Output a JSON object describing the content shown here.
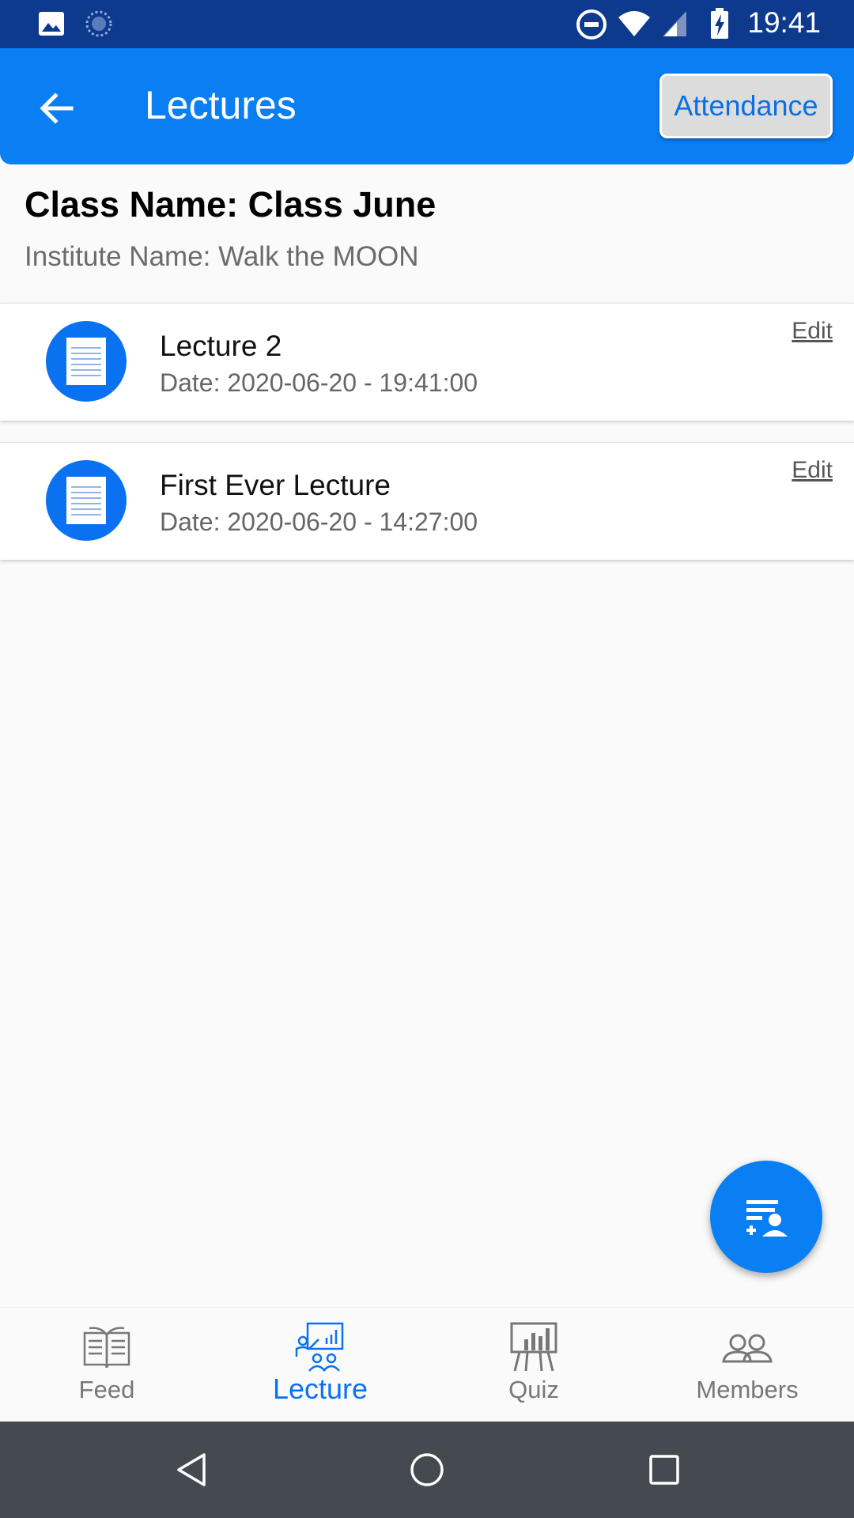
{
  "status_bar": {
    "time": "19:41",
    "icons": [
      "image-icon",
      "loading-icon",
      "do-not-disturb-icon",
      "wifi-icon",
      "signal-icon",
      "battery-charging-icon"
    ]
  },
  "app_bar": {
    "title": "Lectures",
    "back_icon": "arrow-back-icon",
    "attendance_label": "Attendance"
  },
  "class_info": {
    "class_name": "Class Name: Class June",
    "institute_name": "Institute Name: Walk the MOON"
  },
  "lectures": [
    {
      "title": "Lecture 2",
      "date": "Date: 2020-06-20 - 19:41:00",
      "edit_label": "Edit",
      "icon": "document-icon"
    },
    {
      "title": "First Ever Lecture",
      "date": "Date: 2020-06-20 - 14:27:00",
      "edit_label": "Edit",
      "icon": "document-icon"
    }
  ],
  "fab": {
    "icon": "add-lecture-icon"
  },
  "bottom_nav": {
    "items": [
      {
        "label": "Feed",
        "icon": "book-icon",
        "active": false
      },
      {
        "label": "Lecture",
        "icon": "presentation-icon",
        "active": true
      },
      {
        "label": "Quiz",
        "icon": "chart-board-icon",
        "active": false
      },
      {
        "label": "Members",
        "icon": "people-icon",
        "active": false
      }
    ]
  },
  "colors": {
    "primary": "#0a7ff3",
    "status_bar": "#0d3a8c",
    "system_nav": "#454a50",
    "active_tab": "#0a72f0"
  }
}
